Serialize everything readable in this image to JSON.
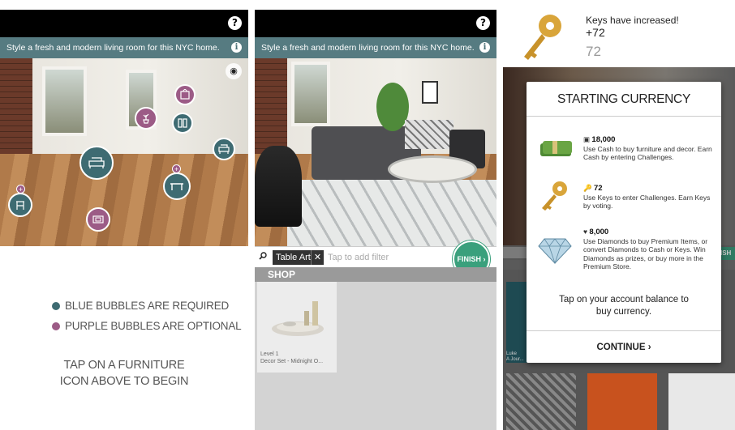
{
  "brand": {
    "blue": "#3e6b72",
    "purple": "#9c5b86",
    "finish_green": "#3aa07c"
  },
  "icons": {
    "help": "question-icon",
    "info": "info-icon",
    "eye": "eye-icon",
    "search": "search-icon",
    "key": "key-icon",
    "cash": "cash-icon",
    "diamond": "diamond-icon"
  },
  "panel1": {
    "help_glyph": "?",
    "banner": "Style a fresh and modern living room for this NYC home.",
    "info_glyph": "i",
    "eye_glyph": "◉",
    "legend_blue": "BLUE BUBBLES ARE REQUIRED",
    "legend_purple": "PURPLE BUBBLES ARE OPTIONAL",
    "tap_line1": "TAP ON A FURNITURE",
    "tap_line2": "ICON ABOVE TO BEGIN",
    "plus": "+"
  },
  "panel2": {
    "help_glyph": "?",
    "banner": "Style a fresh and modern living room for this NYC home.",
    "info_glyph": "i",
    "chip": "Table Art",
    "chip_x": "✕",
    "filter_placeholder": "Tap to add filter",
    "finish": "FINISH ›",
    "shop": "SHOP",
    "card_level": "Level 1",
    "card_name": "Decor Set - Midnight O..."
  },
  "panel3": {
    "keys_title": "Keys have increased!",
    "keys_plus": "+72",
    "keys_value": "72",
    "modal_title": "STARTING CURRENCY",
    "cash_amount": "18,000",
    "cash_desc": "Use Cash to buy furniture and decor. Earn Cash by entering Challenges.",
    "keys_amount": "72",
    "keys_desc": "Use Keys to enter Challenges. Earn Keys by voting.",
    "diamonds_amount": "8,000",
    "diamonds_desc": "Use Diamonds to buy Premium Items, or convert Diamonds to Cash or Keys. Win Diamonds as prizes, or buy more in the Premium Store.",
    "tap_text": "Tap on your account balance to buy currency.",
    "continue": "CONTINUE ›",
    "bg_label": "Luke",
    "bg_label2": "A Jour...",
    "bg_finish": "ISH ›"
  }
}
